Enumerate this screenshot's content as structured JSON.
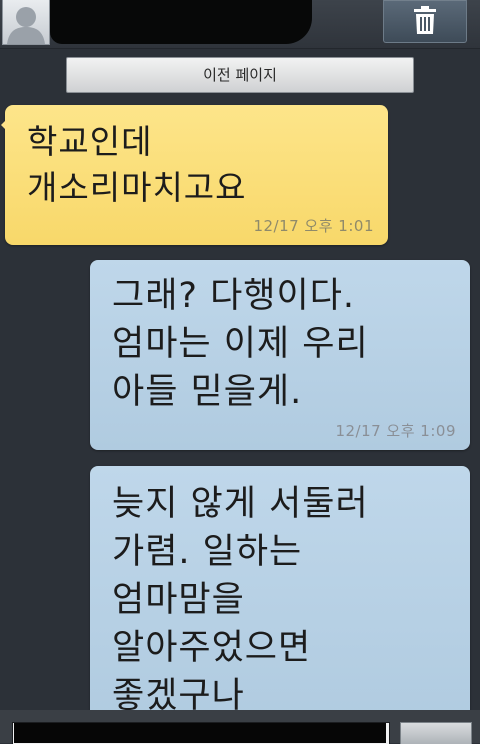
{
  "header": {
    "avatar_icon": "contact-avatar-icon",
    "delete_icon": "trash-icon"
  },
  "navigation": {
    "prev_page_label": "이전 페이지"
  },
  "messages": [
    {
      "direction": "received",
      "text": "학교인데\n개소리마치고요",
      "time": "12/17 오후 1:01",
      "color": "#fde58a"
    },
    {
      "direction": "sent",
      "text": "그래? 다행이다.\n엄마는 이제 우리\n아들 믿을게.",
      "time": "12/17 오후 1:09",
      "color": "#bfd7ea"
    },
    {
      "direction": "sent",
      "text": "늦지 않게 서둘러\n가렴. 일하는\n엄마맘을\n알아주었으면\n좋겠구나",
      "time": "",
      "color": "#bfd7ea"
    }
  ]
}
